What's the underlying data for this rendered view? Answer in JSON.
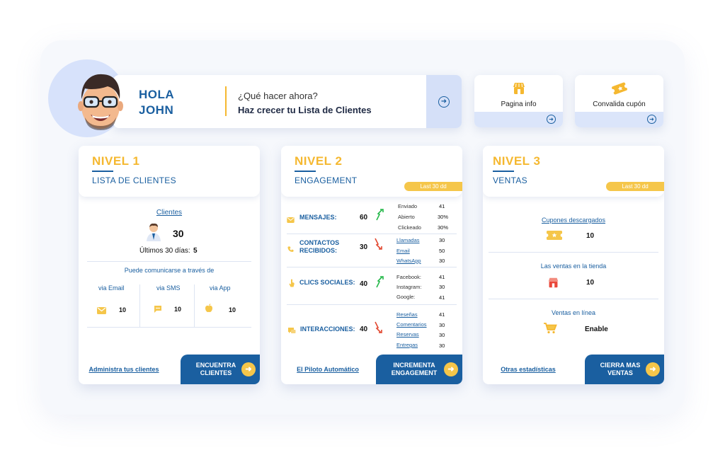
{
  "greeting": {
    "title": "HOLA JOHN",
    "question": "¿Qué hacer ahora?",
    "action": "Haz crecer tu Lista de Clientes"
  },
  "quick_actions": [
    {
      "label": "Pagina info",
      "icon": "store-icon"
    },
    {
      "label": "Convalida cupón",
      "icon": "coupon-icon"
    }
  ],
  "colors": {
    "accent": "#1a5fa0",
    "highlight": "#f5b830",
    "soft": "#d5e0f8"
  },
  "panel1": {
    "level": "NIVEL 1",
    "subtitle": "LISTA DE CLIENTES",
    "clients_link": "Clientes",
    "clients_count": "30",
    "last30_label": "Últimos 30 días:",
    "last30_value": "5",
    "comm_title": "Puede comunicarse a través de",
    "channels": [
      {
        "label": "via Email",
        "icon": "email-icon",
        "value": "10"
      },
      {
        "label": "via SMS",
        "icon": "sms-icon",
        "value": "10"
      },
      {
        "label": "via App",
        "icon": "apple-icon",
        "value": "10"
      }
    ],
    "footer_link": "Administra tus clientes",
    "cta": "ENCUENTRA CLIENTES"
  },
  "panel2": {
    "level": "NIVEL 2",
    "subtitle": "ENGAGEMENT",
    "badge": "Last 30 dd",
    "rows": [
      {
        "label": "MENSAJES:",
        "value": "60",
        "trend": "up",
        "details": [
          {
            "name": "Enviado",
            "value": "41"
          },
          {
            "name": "Abierto",
            "value": "30%"
          },
          {
            "name": "Clickeado",
            "value": "30%"
          }
        ]
      },
      {
        "label": "CONTACTOS RECIBIDOS:",
        "value": "30",
        "trend": "down",
        "details": [
          {
            "name": "Llamadas",
            "value": "30"
          },
          {
            "name": "Email",
            "value": "50"
          },
          {
            "name": "WhatsApp",
            "value": "30"
          }
        ]
      },
      {
        "label": "CLICS SOCIALES:",
        "value": "40",
        "trend": "up",
        "details": [
          {
            "name": "Facebook:",
            "value": "41"
          },
          {
            "name": "Instagram:",
            "value": "30"
          },
          {
            "name": "Google:",
            "value": "41"
          }
        ]
      },
      {
        "label": "INTERACCIONES:",
        "value": "40",
        "trend": "down",
        "details": [
          {
            "name": "Reseñas",
            "value": "41"
          },
          {
            "name": "Comentarios",
            "value": "30"
          },
          {
            "name": "Reservas",
            "value": "30"
          },
          {
            "name": "Entregas",
            "value": "30"
          }
        ]
      }
    ],
    "footer_link": "El Piloto Automático",
    "cta": "INCREMENTA ENGAGEMENT"
  },
  "panel3": {
    "level": "NIVEL 3",
    "subtitle": "VENTAS",
    "badge": "Last 30 dd",
    "coupons_label": "Cupones descargados",
    "coupons_value": "10",
    "store_label": "Las ventas en la tienda",
    "store_value": "10",
    "online_label": "Ventas en línea",
    "online_value": "Enable",
    "footer_link": "Otras estadísticas",
    "cta": "CIERRA MAS VENTAS"
  }
}
